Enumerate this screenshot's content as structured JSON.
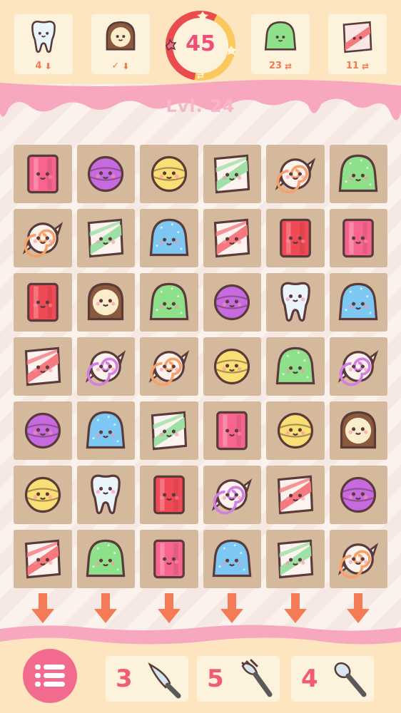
{
  "goals": [
    {
      "piece": "tooth",
      "count": "4",
      "icon": "arrow-down-icon"
    },
    {
      "piece": "cookie",
      "count": "✓",
      "icon": "arrow-down-icon"
    },
    {
      "piece": "gumdrop-green",
      "count": "23",
      "icon": "swap-icon"
    },
    {
      "piece": "mallow-pink",
      "count": "11",
      "icon": "swap-icon"
    }
  ],
  "moves": {
    "value": "45",
    "progress": 0.55
  },
  "level": {
    "label": "Lvl. 24"
  },
  "board": [
    [
      "block-pink",
      "lollipop-purple",
      "lollipop-yellow",
      "mallow-green",
      "swirl-orange",
      "gumdrop-green"
    ],
    [
      "swirl-orange",
      "mallow-green",
      "gumdrop-blue",
      "mallow-pink",
      "block-red",
      "block-pink"
    ],
    [
      "block-red",
      "cookie",
      "gumdrop-green",
      "lollipop-purple",
      "tooth",
      "gumdrop-blue"
    ],
    [
      "mallow-pink",
      "swirl-purple",
      "swirl-orange",
      "lollipop-yellow",
      "gumdrop-green",
      "swirl-purple"
    ],
    [
      "lollipop-purple",
      "gumdrop-blue",
      "mallow-green",
      "block-pink",
      "lollipop-yellow",
      "cookie"
    ],
    [
      "lollipop-yellow",
      "tooth",
      "block-red",
      "swirl-purple",
      "mallow-pink",
      "lollipop-purple"
    ],
    [
      "mallow-pink",
      "gumdrop-green",
      "block-pink",
      "gumdrop-blue",
      "mallow-green",
      "swirl-orange"
    ]
  ],
  "tools": [
    {
      "name": "knife",
      "count": "3",
      "icon": "knife-icon"
    },
    {
      "name": "fork",
      "count": "5",
      "icon": "fork-icon"
    },
    {
      "name": "spoon",
      "count": "4",
      "icon": "spoon-icon"
    }
  ],
  "colors": {
    "drip": "#f7a8bf",
    "accent": "#ef4f77",
    "arrow": "#f47b55",
    "cell": "#d5b99c"
  }
}
